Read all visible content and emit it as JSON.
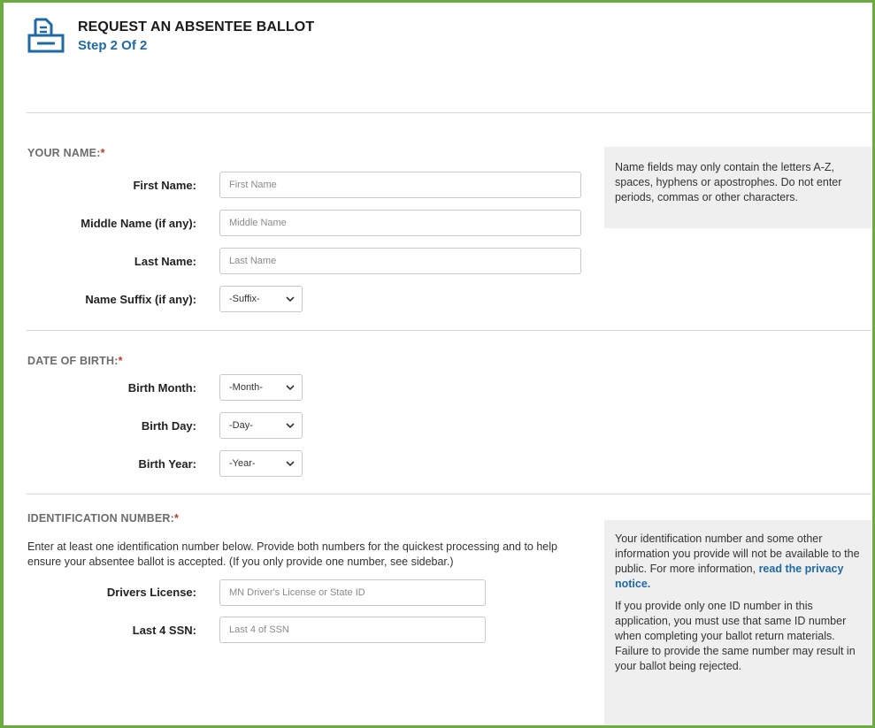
{
  "header": {
    "title": "REQUEST AN ABSENTEE BALLOT",
    "subtitle": "Step 2 Of 2",
    "icon": "ballot-box-icon"
  },
  "colors": {
    "accent": "#1f6aa5",
    "frame": "#6bab42",
    "required": "#c0392b"
  },
  "name_section": {
    "title": "YOUR NAME:",
    "required_mark": "*",
    "first_label": "First Name:",
    "first_placeholder": "First Name",
    "middle_label": "Middle Name (if any):",
    "middle_placeholder": "Middle Name",
    "last_label": "Last Name:",
    "last_placeholder": "Last Name",
    "suffix_label": "Name Suffix (if any):",
    "suffix_value": "-Suffix-",
    "sidebar": "Name fields may only contain the letters A-Z, spaces, hyphens or apostrophes. Do not enter periods, commas or other characters."
  },
  "dob_section": {
    "title": "DATE OF BIRTH:",
    "required_mark": "*",
    "month_label": "Birth Month:",
    "month_value": "-Month-",
    "day_label": "Birth Day:",
    "day_value": "-Day-",
    "year_label": "Birth Year:",
    "year_value": "-Year-"
  },
  "id_section": {
    "title": "IDENTIFICATION NUMBER:",
    "required_mark": "*",
    "instructions": "Enter at least one identification number below. Provide both numbers for the quickest processing and to help ensure your absentee ballot is accepted. (If you only provide one number, see sidebar.)",
    "dl_label": "Drivers License:",
    "dl_placeholder": "MN Driver's License or State ID",
    "ssn_label": "Last 4 SSN:",
    "ssn_placeholder": "Last 4 of SSN",
    "sidebar_p1_text": "Your identification number and some other information you provide will not be available to the public. For more information, ",
    "sidebar_p1_link": "read the privacy notice.",
    "sidebar_p2": "If you provide only one ID number in this application, you must use that same ID number when completing your ballot return materials. Failure to provide the same number may result in your ballot being rejected."
  }
}
